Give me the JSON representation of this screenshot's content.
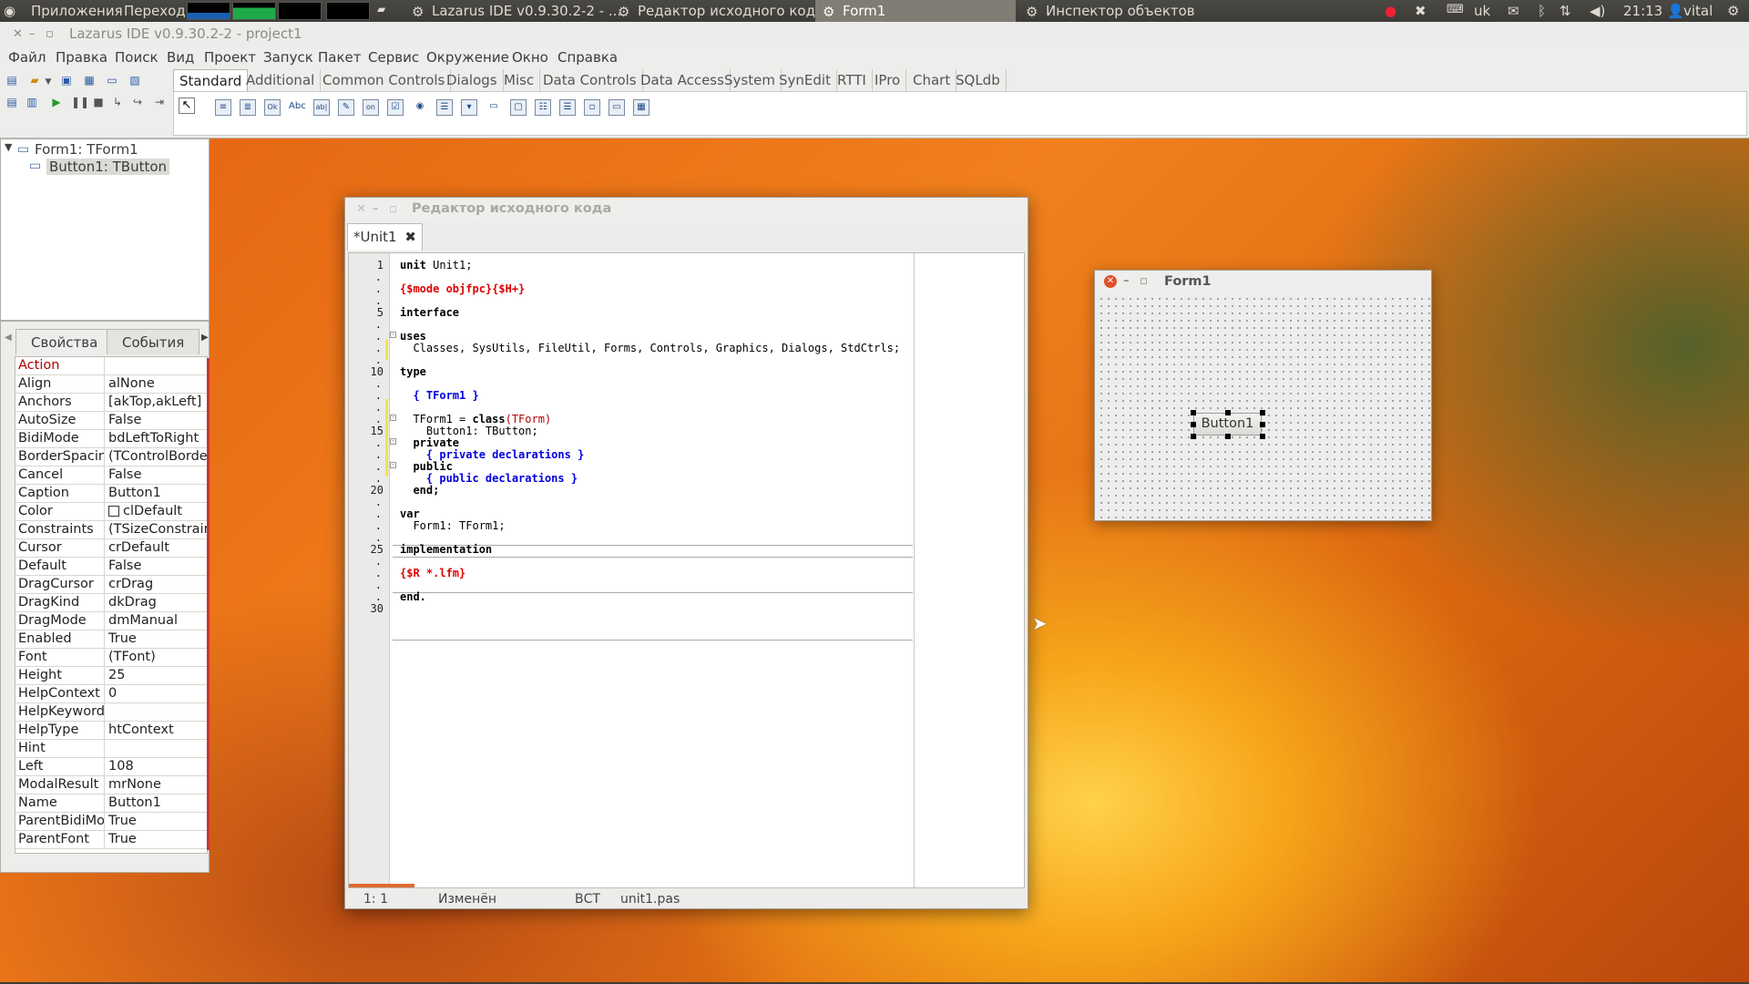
{
  "top_panel": {
    "apps_menu": "Приложения",
    "places_menu": "Переход",
    "tasks": [
      {
        "label": "Lazarus IDE v0.9.30.2-2 - ..."
      },
      {
        "label": "Редактор исходного кода"
      },
      {
        "label": "Form1"
      },
      {
        "label": "Инспектор объектов"
      }
    ],
    "keyboard_layout": "uk",
    "clock": "21:13",
    "user": "vital"
  },
  "ide": {
    "title": "Lazarus IDE v0.9.30.2-2 - project1",
    "menu": [
      "Файл",
      "Правка",
      "Поиск",
      "Вид",
      "Проект",
      "Запуск",
      "Пакет",
      "Сервис",
      "Окружение",
      "Окно",
      "Справка"
    ],
    "palette_tabs": [
      "Standard",
      "Additional",
      "Common Controls",
      "Dialogs",
      "Misc",
      "Data Controls",
      "Data Access",
      "System",
      "SynEdit",
      "RTTI",
      "IPro",
      "Chart",
      "SQLdb"
    ],
    "palette_icon_labels": [
      "Ok",
      "Abc",
      "ab|",
      "on"
    ]
  },
  "object_tree": {
    "root": "Form1: TForm1",
    "child": "Button1: TButton"
  },
  "inspector": {
    "tabs": [
      "Свойства",
      "События"
    ],
    "properties": [
      {
        "name": "Action",
        "value": ""
      },
      {
        "name": "Align",
        "value": "alNone"
      },
      {
        "name": "Anchors",
        "value": "[akTop,akLeft]"
      },
      {
        "name": "AutoSize",
        "value": "False"
      },
      {
        "name": "BidiMode",
        "value": "bdLeftToRight"
      },
      {
        "name": "BorderSpacing",
        "value": "(TControlBorder"
      },
      {
        "name": "Cancel",
        "value": "False"
      },
      {
        "name": "Caption",
        "value": "Button1"
      },
      {
        "name": "Color",
        "value": "clDefault"
      },
      {
        "name": "Constraints",
        "value": "(TSizeConstraint"
      },
      {
        "name": "Cursor",
        "value": "crDefault"
      },
      {
        "name": "Default",
        "value": "False"
      },
      {
        "name": "DragCursor",
        "value": "crDrag"
      },
      {
        "name": "DragKind",
        "value": "dkDrag"
      },
      {
        "name": "DragMode",
        "value": "dmManual"
      },
      {
        "name": "Enabled",
        "value": "True"
      },
      {
        "name": "Font",
        "value": "(TFont)"
      },
      {
        "name": "Height",
        "value": "25"
      },
      {
        "name": "HelpContext",
        "value": "0"
      },
      {
        "name": "HelpKeyword",
        "value": ""
      },
      {
        "name": "HelpType",
        "value": "htContext"
      },
      {
        "name": "Hint",
        "value": ""
      },
      {
        "name": "Left",
        "value": "108"
      },
      {
        "name": "ModalResult",
        "value": "mrNone"
      },
      {
        "name": "Name",
        "value": "Button1"
      },
      {
        "name": "ParentBidiMode",
        "value": "True"
      },
      {
        "name": "ParentFont",
        "value": "True"
      }
    ]
  },
  "editor": {
    "title": "Редактор исходного кода",
    "tab": "*Unit1",
    "line_numbers": [
      "1",
      "5",
      "10",
      "15",
      "20",
      "25",
      "30"
    ],
    "code": {
      "l1": "unit Unit1;",
      "l3": "{$mode objfpc}{$H+}",
      "l5": "interface",
      "l7": "uses",
      "l8": "  Classes, SysUtils, FileUtil, Forms, Controls, Graphics, Dialogs, StdCtrls;",
      "l10": "type",
      "l12": "  { TForm1 }",
      "l14a": "  TForm1 = ",
      "l14b": "class",
      "l14c": "(TForm)",
      "l15": "    Button1: TButton;",
      "l16": "  private",
      "l17": "    { private declarations }",
      "l18": "  public",
      "l19": "    { public declarations }",
      "l20": "  end;",
      "l22": "var",
      "l23": "  Form1: TForm1;",
      "l25": "implementation",
      "l27": "{$R *.lfm}",
      "l29": "end."
    },
    "status": {
      "position": "1:  1",
      "modified": "Изменён",
      "mode": "ВСТ",
      "file": "unit1.pas"
    }
  },
  "form1": {
    "title": "Form1",
    "button_caption": "Button1"
  }
}
